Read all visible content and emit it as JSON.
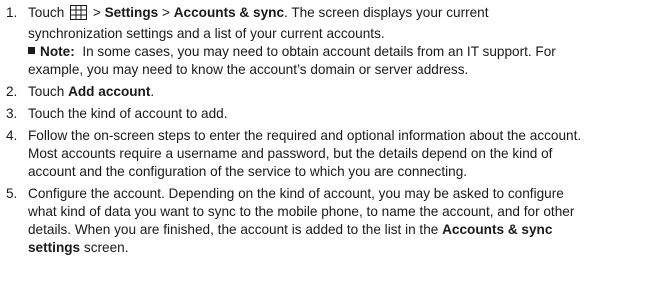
{
  "steps": [
    {
      "num": "1.",
      "touch": "Touch",
      "sep1": ">",
      "settings": "Settings",
      "sep2": ">",
      "accounts_sync": "Accounts & sync",
      "after": ". The screen displays your current",
      "line2": "synchronization settings and a list of your current accounts.",
      "note_label": "Note:",
      "note_line1": "In some cases, you may need to obtain account details from an IT support. For",
      "note_line2": "example, you may need to know the account’s domain or server address."
    },
    {
      "num": "2.",
      "touch": "Touch",
      "add_account": "Add account",
      "period": "."
    },
    {
      "num": "3.",
      "text": "Touch the kind of account to add."
    },
    {
      "num": "4.",
      "line1": "Follow the on-screen steps to enter the required and optional information about the account.",
      "line2": "Most accounts require a username and password, but the details depend on the kind of",
      "line3": "account and the configuration of the service to which you are connecting."
    },
    {
      "num": "5.",
      "line1": "Configure the account. Depending on the kind of account, you may be asked to configure",
      "line2": "what kind of data you want to sync to the mobile phone, to name the account, and for other",
      "line3_pre": "details. When you are finished, the account is added to the list in the",
      "line3_bold": "Accounts & sync",
      "line4_bold": "settings",
      "line4_post": "screen."
    }
  ],
  "icons": {
    "menu": "menu-grid-icon"
  },
  "colors": {
    "text": "#1a1a1a"
  }
}
